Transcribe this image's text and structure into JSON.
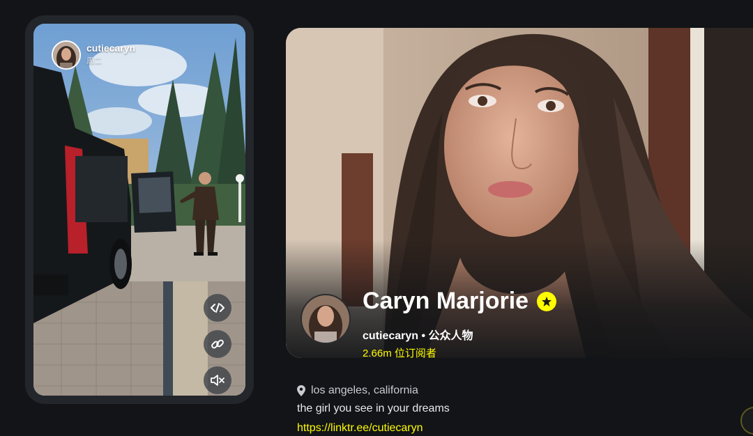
{
  "story": {
    "username": "cutiecaryn",
    "time_label": "周二",
    "controls": [
      {
        "name": "embed-button",
        "icon": "embed-code-icon"
      },
      {
        "name": "copy-link-button",
        "icon": "link-icon"
      },
      {
        "name": "mute-button",
        "icon": "speaker-muted-icon"
      }
    ]
  },
  "profile": {
    "display_name": "Caryn Marjorie",
    "handle_line": "cutiecaryn • 公众人物",
    "subscribers": "2.66m 位订阅者",
    "badge_icon": "star-icon"
  },
  "bio": {
    "location_icon": "location-pin-icon",
    "location": "los angeles, california",
    "description": "the girl you see in your dreams",
    "link": "https://linktr.ee/cutiecaryn"
  },
  "colors": {
    "background": "#121417",
    "accent_yellow": "#fffc00",
    "card": "#23262b"
  }
}
